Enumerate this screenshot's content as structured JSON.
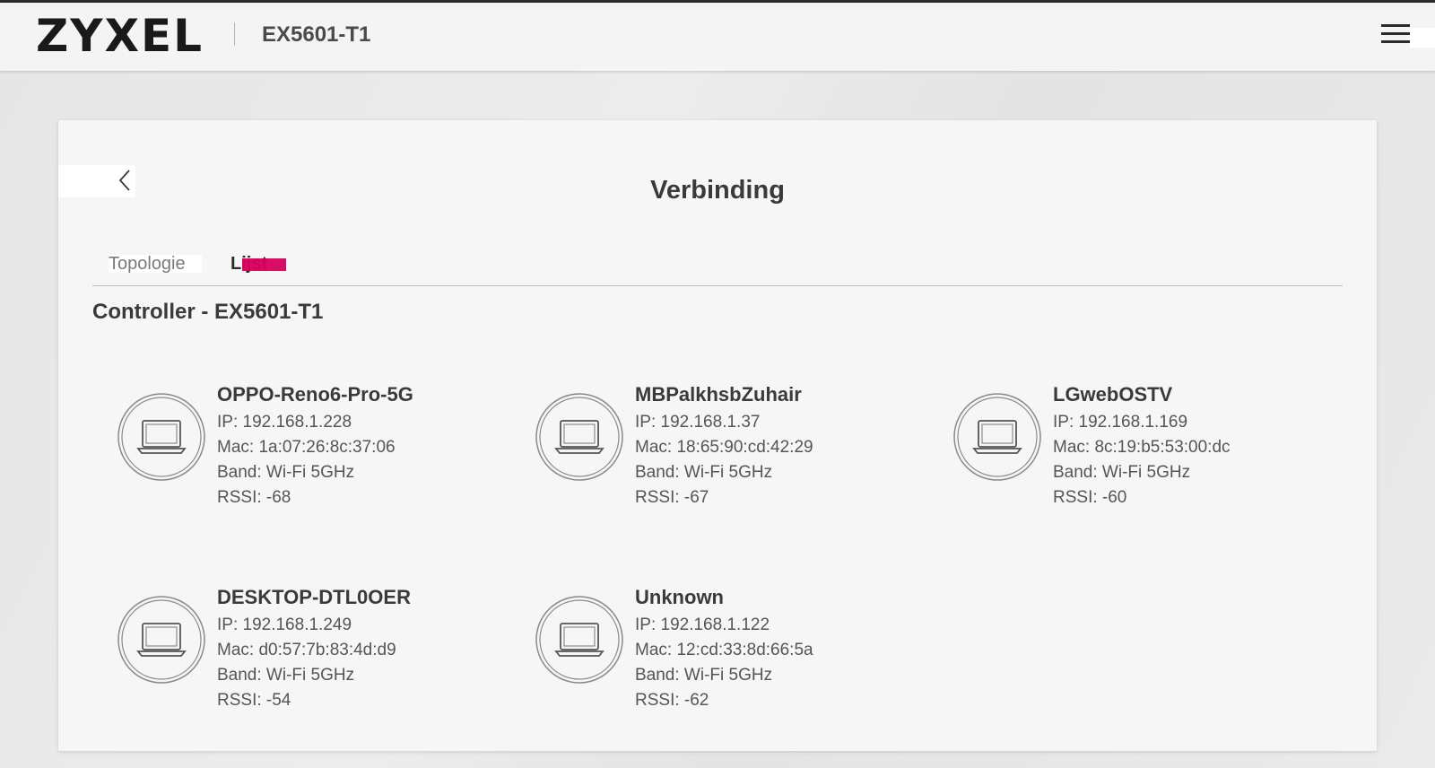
{
  "header": {
    "logo": "ZYXEL",
    "model": "EX5601-T1"
  },
  "page": {
    "title": "Verbinding",
    "tabs": [
      {
        "label": "Topologie",
        "active": false
      },
      {
        "label": "Lijst",
        "active": true
      }
    ],
    "controller_label": "Controller - EX5601-T1"
  },
  "labels": {
    "ip": "IP:",
    "mac": "Mac:",
    "band": "Band:",
    "rssi": "RSSI:"
  },
  "devices": [
    {
      "name": "OPPO-Reno6-Pro-5G",
      "ip": "IP: 192.168.1.228",
      "mac": "Mac: 1a:07:26:8c:37:06",
      "band": "Band: Wi-Fi 5GHz",
      "rssi": "RSSI: -68"
    },
    {
      "name": "MBPalkhsbZuhair",
      "ip": "IP: 192.168.1.37",
      "mac": "Mac: 18:65:90:cd:42:29",
      "band": "Band: Wi-Fi 5GHz",
      "rssi": "RSSI: -67"
    },
    {
      "name": "LGwebOSTV",
      "ip": "IP: 192.168.1.169",
      "mac": "Mac: 8c:19:b5:53:00:dc",
      "band": "Band: Wi-Fi 5GHz",
      "rssi": "RSSI: -60"
    },
    {
      "name": "DESKTOP-DTL0OER",
      "ip": "IP: 192.168.1.249",
      "mac": "Mac: d0:57:7b:83:4d:d9",
      "band": "Band: Wi-Fi 5GHz",
      "rssi": "RSSI: -54"
    },
    {
      "name": "Unknown",
      "ip": "IP: 192.168.1.122",
      "mac": "Mac: 12:cd:33:8d:66:5a",
      "band": "Band: Wi-Fi 5GHz",
      "rssi": "RSSI: -62"
    }
  ],
  "icons": {
    "menu": "hamburger-menu-icon",
    "back": "chevron-left-icon",
    "device": "laptop-icon"
  },
  "colors": {
    "accent": "#d6005b",
    "text_dark": "#3a3a3a"
  }
}
